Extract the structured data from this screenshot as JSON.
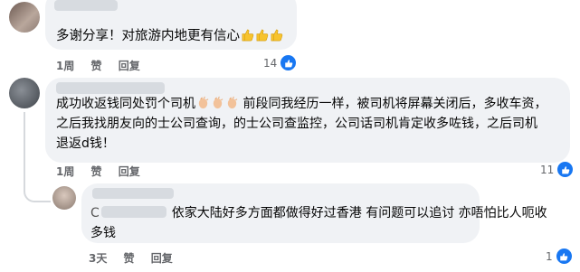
{
  "comments": [
    {
      "text_lines": [
        "多谢分享！对旅游内地更有信心"
      ],
      "emoji_after": [
        "thumbs-up-emoji",
        "thumbs-up-emoji",
        "thumbs-up-emoji"
      ],
      "time": "1周",
      "like": "赞",
      "reply": "回复",
      "reaction_count": "14"
    },
    {
      "text_lines": [
        "成功收返钱同处罚个司机",
        "前段同我经历一样，被司机将屏幕关闭后，多收车资，",
        "之后我找朋友向的士公司查询，的士公司查监控，公司话司机肯定收多咗钱，之后司机",
        "退返d钱！"
      ],
      "emoji_inline": [
        "clapping-emoji",
        "clapping-emoji",
        "clapping-emoji"
      ],
      "time": "1周",
      "like": "赞",
      "reply": "回复",
      "reaction_count": "11"
    },
    {
      "text_lines": [
        "依家大陆好多方面都做得好过香港 有问题可以追讨 亦唔怕比人呃收",
        "多钱"
      ],
      "mention_prefix": "C",
      "time": "3天",
      "like": "赞",
      "reply": "回复",
      "reaction_count": "1"
    }
  ],
  "colors": {
    "bubble": "#f0f2f5",
    "meta_text": "#65676b",
    "like_blue": "#1877f2",
    "emoji_yellow": "#f7c32e"
  }
}
